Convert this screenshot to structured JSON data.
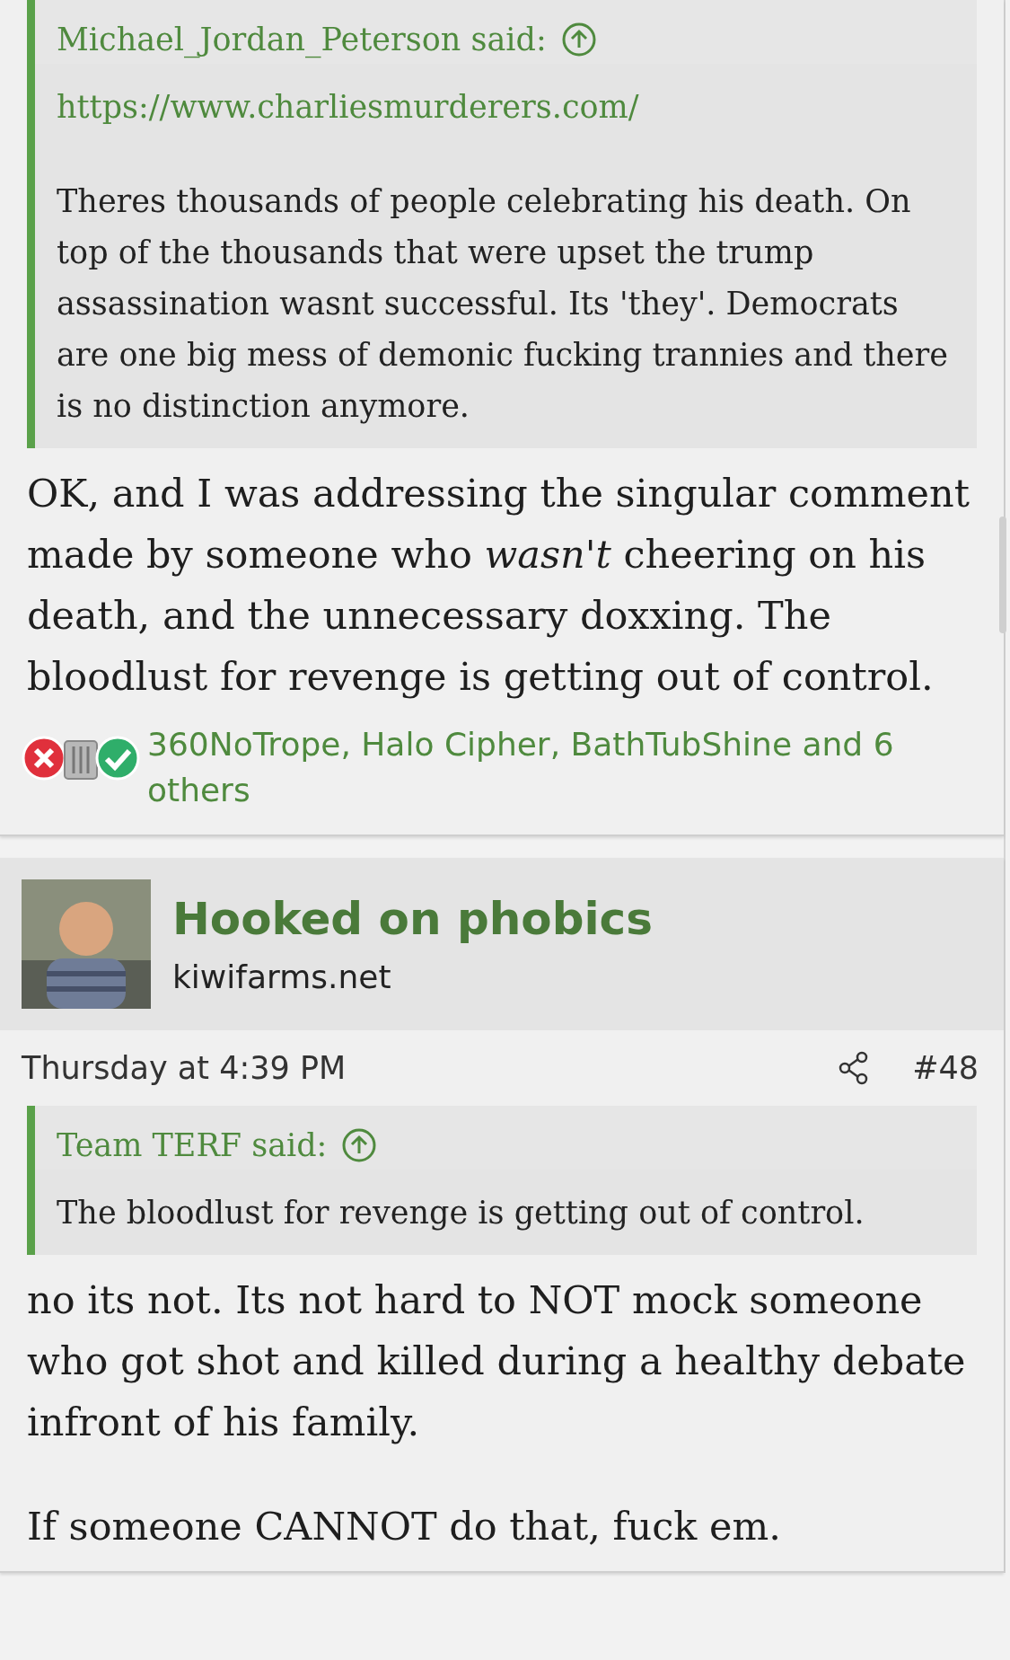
{
  "posts": [
    {
      "quote": {
        "author": "Michael_Jordan_Peterson said:",
        "link": "https://www.charliesmurderers.com/",
        "text": "Theres thousands of people celebrating his death. On top of the thousands that were upset the trump assassination wasnt successful. Its 'they'. Democrats are one big mess of demonic fucking trannies and there is no distinction anymore."
      },
      "body": [
        "OK, and I was addressing the singular comment made by someone who *wasn't* cheering on his death, and the unnecessary doxxing. The bloodlust for revenge is getting out of control."
      ],
      "reactions": {
        "icons": [
          {
            "kind": "disagree"
          },
          {
            "kind": "trash"
          },
          {
            "kind": "agree"
          }
        ],
        "text": "360NoTrope, Halo Cipher, BathTubShine and 6 others"
      }
    },
    {
      "author": {
        "name": "Hooked on phobics",
        "site": "kiwifarms.net"
      },
      "date": "Thursday at 4:39 PM",
      "number": "#48",
      "quote": {
        "author": "Team TERF said:",
        "text": "The bloodlust for revenge is getting out of control."
      },
      "body": [
        "no its not. Its not hard to NOT mock someone who got shot and killed during a healthy debate infront of his family.",
        "If someone CANNOT do that, fuck em."
      ]
    }
  ]
}
